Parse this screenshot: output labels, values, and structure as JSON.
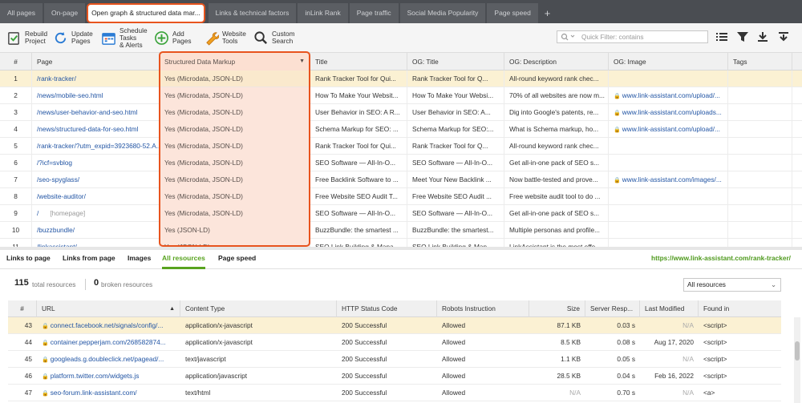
{
  "tabs": [
    {
      "label": "All pages"
    },
    {
      "label": "On-page"
    },
    {
      "label": "Open graph & structured data mar..."
    },
    {
      "label": "Links & technical factors"
    },
    {
      "label": "inLink Rank"
    },
    {
      "label": "Page traffic"
    },
    {
      "label": "Social Media Popularity"
    },
    {
      "label": "Page speed"
    }
  ],
  "tab_plus": "+",
  "toolbar": {
    "rebuild": "Rebuild\nProject",
    "update": "Update\nPages",
    "schedule": "Schedule\nTasks\n& Alerts",
    "add": "Add\nPages",
    "website_tools": "Website\nTools",
    "custom_search": "Custom\nSearch",
    "quick_filter_placeholder": "Quick Filter: contains"
  },
  "grid": {
    "headers": {
      "num": "#",
      "page": "Page",
      "sdm": "Structured Data Markup",
      "title": "Title",
      "og_title": "OG: Title",
      "og_desc": "OG: Description",
      "og_image": "OG: Image",
      "tags": "Tags"
    },
    "rows": [
      {
        "num": "1",
        "page": "/rank-tracker/",
        "hp": "",
        "sdm": "Yes (Microdata, JSON-LD)",
        "title": "Rank Tracker Tool for Qui...",
        "og_title": "Rank Tracker Tool for Q...",
        "og_desc": "All-round keyword rank chec...",
        "og_image": ""
      },
      {
        "num": "2",
        "page": "/news/mobile-seo.html",
        "hp": "",
        "sdm": "Yes (Microdata, JSON-LD)",
        "title": "How To Make Your Websit...",
        "og_title": "How To Make Your Websi...",
        "og_desc": "70% of all websites are now m...",
        "og_image": "www.link-assistant.com/upload/..."
      },
      {
        "num": "3",
        "page": "/news/user-behavior-and-seo.html",
        "hp": "",
        "sdm": "Yes (Microdata, JSON-LD)",
        "title": "User Behavior in SEO: A R...",
        "og_title": "User Behavior in SEO: A...",
        "og_desc": "Dig into Google's patents, re...",
        "og_image": "www.link-assistant.com/uploads..."
      },
      {
        "num": "4",
        "page": "/news/structured-data-for-seo.html",
        "hp": "",
        "sdm": "Yes (Microdata, JSON-LD)",
        "title": "Schema Markup for SEO: ...",
        "og_title": "Schema Markup for SEO:...",
        "og_desc": "What is Schema markup, ho...",
        "og_image": "www.link-assistant.com/upload/..."
      },
      {
        "num": "5",
        "page": "/rank-tracker/?utm_expid=3923680-52.A...",
        "hp": "",
        "sdm": "Yes (Microdata, JSON-LD)",
        "title": "Rank Tracker Tool for Qui...",
        "og_title": "Rank Tracker Tool for Q...",
        "og_desc": "All-round keyword rank chec...",
        "og_image": ""
      },
      {
        "num": "6",
        "page": "/?icf=svblog",
        "hp": "",
        "sdm": "Yes (Microdata, JSON-LD)",
        "title": "SEO Software — All-In-O...",
        "og_title": "SEO Software — All-In-O...",
        "og_desc": "Get all-in-one pack of SEO s...",
        "og_image": ""
      },
      {
        "num": "7",
        "page": "/seo-spyglass/",
        "hp": "",
        "sdm": "Yes (Microdata, JSON-LD)",
        "title": "Free Backlink Software to ...",
        "og_title": "Meet Your New Backlink ...",
        "og_desc": "Now battle-tested and prove...",
        "og_image": "www.link-assistant.com/images/..."
      },
      {
        "num": "8",
        "page": "/website-auditor/",
        "hp": "",
        "sdm": "Yes (Microdata, JSON-LD)",
        "title": "Free Website SEO Audit T...",
        "og_title": "Free Website SEO Audit ...",
        "og_desc": "Free website audit tool to do ...",
        "og_image": ""
      },
      {
        "num": "9",
        "page": "/",
        "hp": "[homepage]",
        "sdm": "Yes (Microdata, JSON-LD)",
        "title": "SEO Software — All-In-O...",
        "og_title": "SEO Software — All-In-O...",
        "og_desc": "Get all-in-one pack of SEO s...",
        "og_image": ""
      },
      {
        "num": "10",
        "page": "/buzzbundle/",
        "hp": "",
        "sdm": "Yes (JSON-LD)",
        "title": "BuzzBundle: the smartest ...",
        "og_title": "BuzzBundle: the smartest...",
        "og_desc": "Multiple personas and profile...",
        "og_image": ""
      },
      {
        "num": "11",
        "page": "/linkassistant/",
        "hp": "",
        "sdm": "Yes (JSON-LD)",
        "title": "SEO Link Building & Mana...",
        "og_title": "SEO Link Building & Man...",
        "og_desc": "LinkAssistant is the most effe...",
        "og_image": ""
      }
    ]
  },
  "lower": {
    "tabs": [
      {
        "label": "Links to page"
      },
      {
        "label": "Links from page"
      },
      {
        "label": "Images"
      },
      {
        "label": "All resources"
      },
      {
        "label": "Page speed"
      }
    ],
    "page_url": "https://www.link-assistant.com/rank-tracker/",
    "total_count": "115",
    "total_label": "total resources",
    "broken_count": "0",
    "broken_label": "broken resources",
    "filter_value": "All resources",
    "headers": {
      "num": "#",
      "url": "URL",
      "ctype": "Content Type",
      "status": "HTTP Status Code",
      "robots": "Robots Instruction",
      "size": "Size",
      "resp": "Server Resp...",
      "modified": "Last Modified",
      "found": "Found in"
    },
    "rows": [
      {
        "num": "43",
        "url": "connect.facebook.net/signals/config/...",
        "ctype": "application/x-javascript",
        "status": "200 Successful",
        "robots": "Allowed",
        "size": "87.1 KB",
        "resp": "0.03 s",
        "modified": "N/A",
        "found": "<script>"
      },
      {
        "num": "44",
        "url": "container.pepperjam.com/268582874...",
        "ctype": "application/x-javascript",
        "status": "200 Successful",
        "robots": "Allowed",
        "size": "8.5 KB",
        "resp": "0.08 s",
        "modified": "Aug 17, 2020",
        "found": "<script>"
      },
      {
        "num": "45",
        "url": "googleads.g.doubleclick.net/pagead/...",
        "ctype": "text/javascript",
        "status": "200 Successful",
        "robots": "Allowed",
        "size": "1.1 KB",
        "resp": "0.05 s",
        "modified": "N/A",
        "found": "<script>"
      },
      {
        "num": "46",
        "url": "platform.twitter.com/widgets.js",
        "ctype": "application/javascript",
        "status": "200 Successful",
        "robots": "Allowed",
        "size": "28.5 KB",
        "resp": "0.04 s",
        "modified": "Feb 16, 2022",
        "found": "<script>"
      },
      {
        "num": "47",
        "url": "seo-forum.link-assistant.com/",
        "ctype": "text/html",
        "status": "200 Successful",
        "robots": "Allowed",
        "size": "N/A",
        "resp": "0.70 s",
        "modified": "N/A",
        "found": "<a>"
      }
    ]
  },
  "colors": {
    "accent_orange": "#e8541e",
    "accent_green": "#58a31f",
    "link_blue": "#2255a4",
    "selected_row": "#fbf1d3"
  }
}
